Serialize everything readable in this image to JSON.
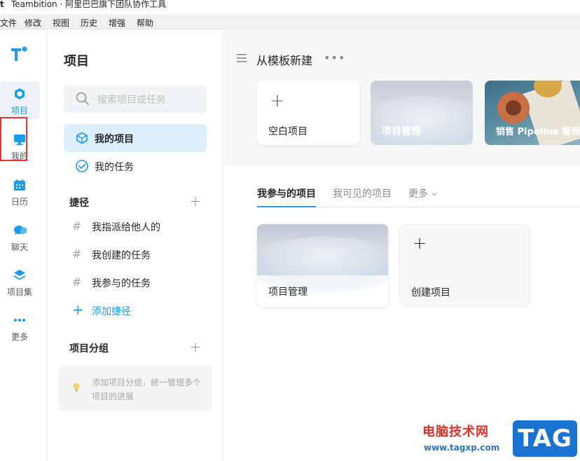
{
  "window": {
    "title": "Teambition · 阿里巴巴旗下团队协作工具"
  },
  "menubar": {
    "items": [
      "文件",
      "修改",
      "视图",
      "历史",
      "增强",
      "帮助"
    ]
  },
  "rail": {
    "items": [
      {
        "label": "项目",
        "icon": "cube-icon",
        "active": true
      },
      {
        "label": "我的",
        "icon": "monitor-icon"
      },
      {
        "label": "日历",
        "icon": "calendar-icon"
      },
      {
        "label": "聊天",
        "icon": "chat-icon"
      },
      {
        "label": "项目集",
        "icon": "layers-icon"
      },
      {
        "label": "更多",
        "icon": "more-icon"
      }
    ],
    "brand_color": "#1b9aee",
    "highlight_color": "#e8352d"
  },
  "panel": {
    "title": "项目",
    "search_placeholder": "搜索项目或任务",
    "nav": [
      {
        "label": "我的项目",
        "active": true
      },
      {
        "label": "我的任务"
      }
    ],
    "shortcuts": {
      "heading": "捷径",
      "items": [
        "我指派给他人的",
        "我创建的任务",
        "我参与的任务"
      ],
      "add_label": "添加捷径"
    },
    "groups": {
      "heading": "项目分组",
      "tip": "添加项目分组，统一管理多个项目的进展"
    }
  },
  "main": {
    "template_header": "从模板新建",
    "templates": [
      {
        "label": "空白项目"
      },
      {
        "label": "项目管理"
      },
      {
        "label": "销售 Pipeline 管理"
      }
    ],
    "tabs": [
      {
        "label": "我参与的项目",
        "active": true
      },
      {
        "label": "我可见的项目"
      },
      {
        "label": "更多"
      }
    ],
    "projects": [
      {
        "label": "项目管理"
      }
    ],
    "create_label": "创建项目"
  },
  "watermark": {
    "cn": "电脑技术网",
    "url": "www.tagxp.com",
    "tag": "TAG"
  }
}
